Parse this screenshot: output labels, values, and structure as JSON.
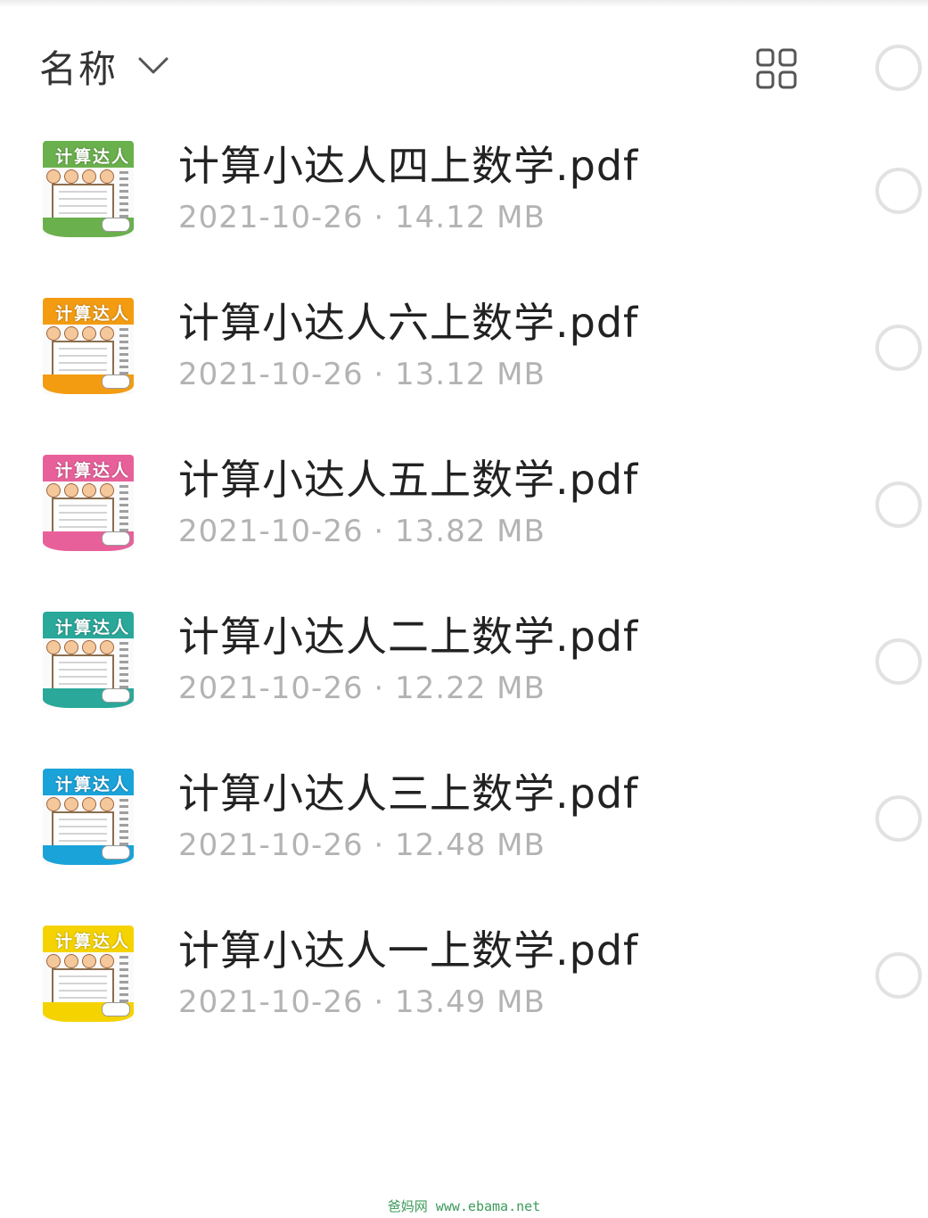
{
  "header": {
    "sort_label": "名称",
    "sort_icon": "chevron-down-icon",
    "view_toggle_icon": "grid-view-icon",
    "select_all_icon": "circle-icon"
  },
  "files": [
    {
      "name": "计算小达人四上数学.pdf",
      "meta": "2021-10-26 · 14.12 MB",
      "thumb_color": "#6ab04c",
      "thumb_title": "计算达人"
    },
    {
      "name": "计算小达人六上数学.pdf",
      "meta": "2021-10-26 · 13.12 MB",
      "thumb_color": "#f39c12",
      "thumb_title": "计算达人"
    },
    {
      "name": "计算小达人五上数学.pdf",
      "meta": "2021-10-26 · 13.82 MB",
      "thumb_color": "#e8609a",
      "thumb_title": "计算达人"
    },
    {
      "name": "计算小达人二上数学.pdf",
      "meta": "2021-10-26 · 12.22 MB",
      "thumb_color": "#2aa89a",
      "thumb_title": "计算达人"
    },
    {
      "name": "计算小达人三上数学.pdf",
      "meta": "2021-10-26 · 12.48 MB",
      "thumb_color": "#1aa3d9",
      "thumb_title": "计算达人"
    },
    {
      "name": "计算小达人一上数学.pdf",
      "meta": "2021-10-26 · 13.49 MB",
      "thumb_color": "#f5d300",
      "thumb_title": "计算达人"
    }
  ],
  "watermark": "爸妈网 www.ebama.net",
  "colors": {
    "text_primary": "#222222",
    "text_secondary": "#b3b3b3",
    "circle_border": "#e2e2e2",
    "watermark": "#3c9a5a"
  }
}
